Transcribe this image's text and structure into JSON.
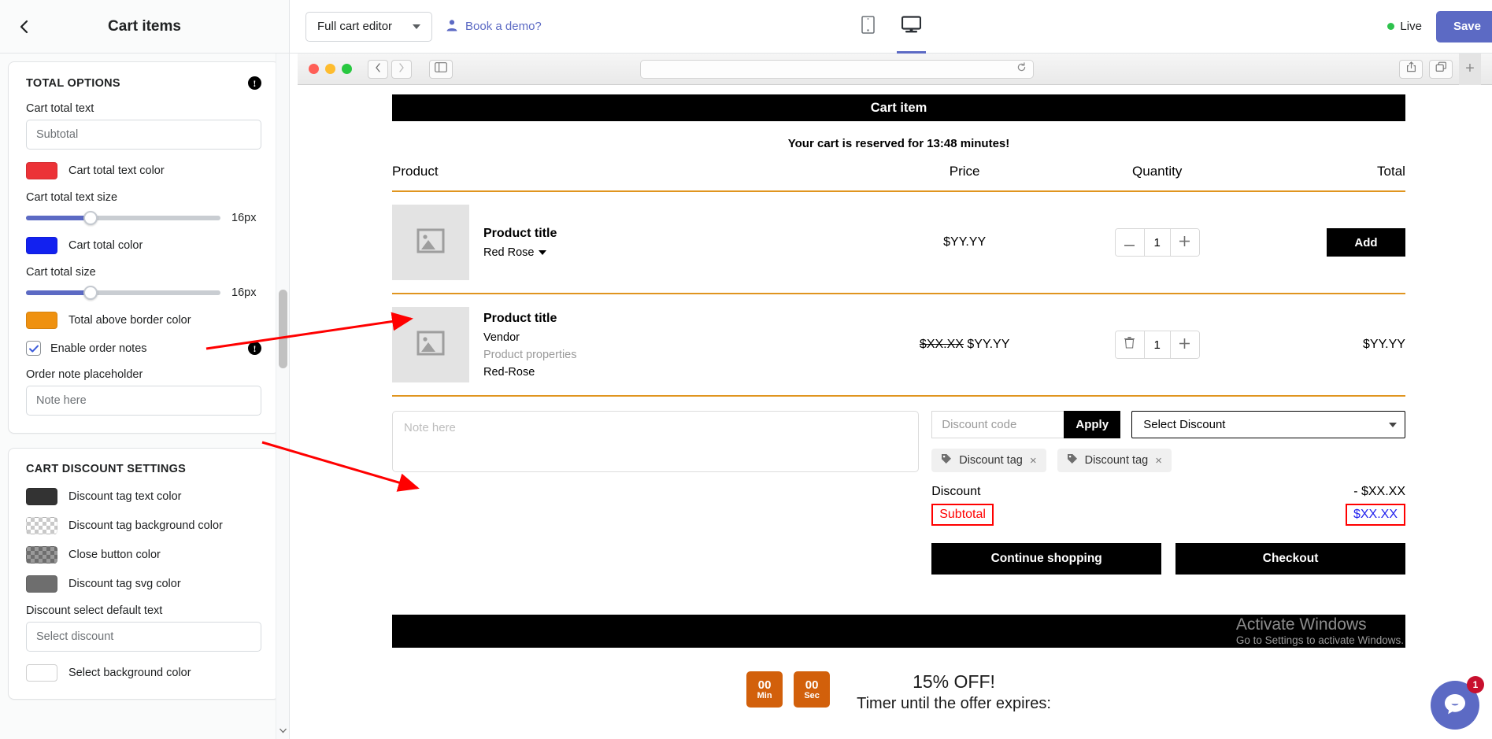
{
  "sidebar": {
    "title": "Cart items",
    "back_icon": "chevron-left-icon",
    "sections": [
      {
        "id": "total-options",
        "title": "TOTAL OPTIONS",
        "info_badge": "!",
        "fields": {
          "cart_total_text_label": "Cart total text",
          "cart_total_text_value": "Subtotal",
          "cart_total_text_color_label": "Cart total text color",
          "cart_total_text_color": "#ec3237",
          "cart_total_text_size_label": "Cart total text size",
          "cart_total_text_size_value": "16px",
          "cart_total_color_label": "Cart total color",
          "cart_total_color": "#1221f0",
          "cart_total_size_label": "Cart total size",
          "cart_total_size_value": "16px",
          "total_above_border_color_label": "Total above border color",
          "total_above_border_color": "#ef9110",
          "enable_order_notes_label": "Enable order notes",
          "enable_order_notes_checked": true,
          "order_note_placeholder_label": "Order note placeholder",
          "order_note_placeholder_value": "Note here"
        }
      },
      {
        "id": "cart-discount-settings",
        "title": "CART DISCOUNT SETTINGS",
        "fields": {
          "discount_tag_text_color_label": "Discount tag text color",
          "discount_tag_text_color": "#333333",
          "discount_tag_background_color_label": "Discount tag background color",
          "close_button_color_label": "Close button color",
          "discount_tag_svg_color_label": "Discount tag svg color",
          "discount_tag_svg_color": "#6e6e6e",
          "discount_select_default_text_label": "Discount select default text",
          "discount_select_default_text_value": "Select discount",
          "select_background_color_label": "Select background color",
          "select_background_color": "#ffffff"
        }
      }
    ]
  },
  "topbar": {
    "editor_select": "Full cart editor",
    "demo_link": "Book a demo?",
    "demo_icon": "person-icon",
    "device_mobile_icon": "mobile-icon",
    "device_desktop_icon": "desktop-icon",
    "active_device": "desktop",
    "live_label": "Live",
    "live_color": "#2ec24d",
    "save_label": "Save",
    "save_color": "#5c6ac4"
  },
  "browser_chrome": {
    "back_icon": "chevron-left-icon",
    "forward_icon": "chevron-right-icon",
    "sidebar_icon": "panel-icon",
    "reload_icon": "reload-icon",
    "share_icon": "share-icon",
    "tabs_icon": "copy-tabs-icon",
    "new_tab_icon": "plus-icon"
  },
  "preview": {
    "cart_header": "Cart item",
    "reserve_message": "Your cart is reserved for 13:48 minutes!",
    "columns": {
      "product": "Product",
      "price": "Price",
      "quantity": "Quantity",
      "total": "Total"
    },
    "border_color": "#e0951f",
    "rows": [
      {
        "image_icon": "image-placeholder-icon",
        "title": "Product title",
        "variant": "Red Rose",
        "variant_caret": "caret-down-icon",
        "price": "$YY.YY",
        "price_old": "",
        "qty_minus_icon": "minus-icon",
        "qty": "1",
        "qty_plus_icon": "plus-icon",
        "action": "Add",
        "total": ""
      },
      {
        "image_icon": "image-placeholder-icon",
        "title": "Product title",
        "vendor": "Vendor",
        "properties": "Product properties",
        "variant": "Red-Rose",
        "price_old": "$XX.XX",
        "price": "$YY.YY",
        "qty_trash_icon": "trash-icon",
        "qty": "1",
        "qty_plus_icon": "plus-icon",
        "total": "$YY.YY"
      }
    ],
    "note_placeholder": "Note here",
    "discount": {
      "code_placeholder": "Discount code",
      "apply_label": "Apply",
      "select_label": "Select Discount",
      "select_caret": "caret-down-icon",
      "tags": [
        {
          "icon": "tag-icon",
          "label": "Discount tag",
          "close": "×"
        },
        {
          "icon": "tag-icon",
          "label": "Discount tag",
          "close": "×"
        }
      ],
      "discount_label": "Discount",
      "discount_value": "- $XX.XX",
      "subtotal_label": "Subtotal",
      "subtotal_value": "$XX.XX",
      "subtotal_label_color": "#ff0000",
      "subtotal_value_color": "#2222ee",
      "highlight_color": "#ff0000"
    },
    "cta": {
      "continue": "Continue shopping",
      "checkout": "Checkout"
    },
    "timer": {
      "boxes": [
        {
          "num": "00",
          "unit": "Min"
        },
        {
          "num": "00",
          "unit": "Sec"
        }
      ],
      "headline": "15% OFF!",
      "sub": "Timer until the offer expires:",
      "box_color": "#d2600b"
    }
  },
  "watermark": {
    "line1": "Activate Windows",
    "line2": "Go to Settings to activate Windows."
  },
  "chat": {
    "icon": "chat-bubble-icon",
    "badge": "1",
    "color": "#5c6ac4"
  }
}
